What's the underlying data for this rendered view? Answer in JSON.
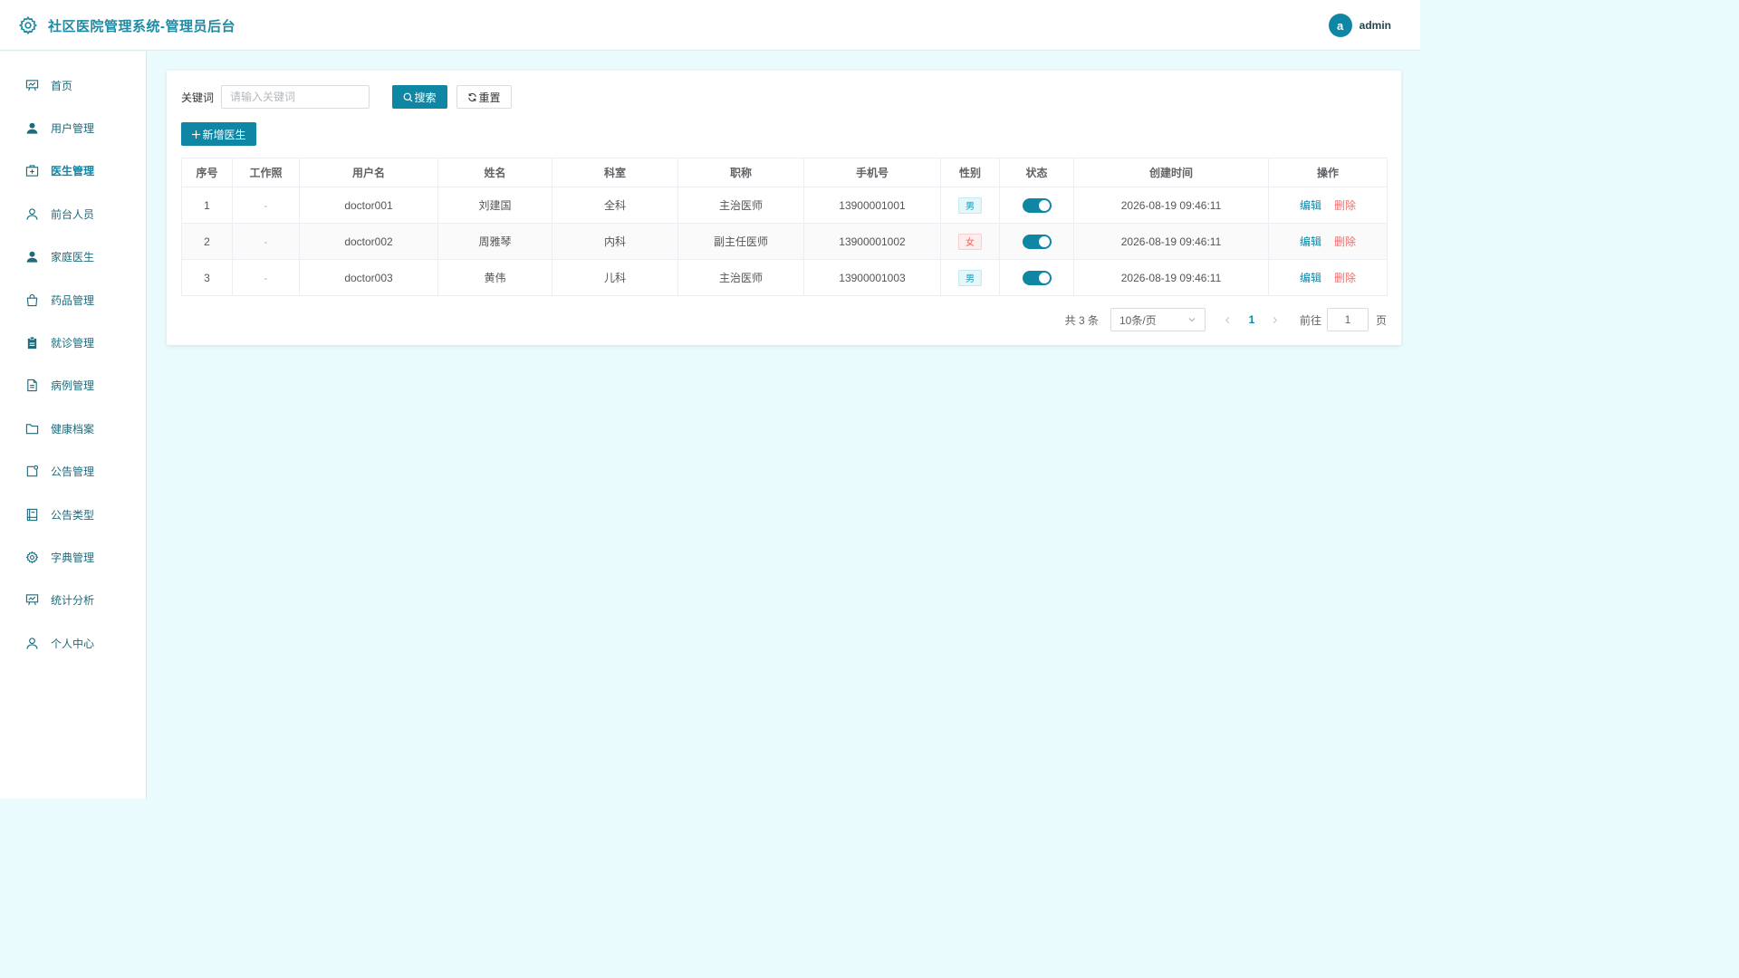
{
  "header": {
    "title": "社区医院管理系统-管理员后台",
    "avatar_letter": "a",
    "username": "admin",
    "logo_icon": "gear-icon"
  },
  "sidebar": {
    "items": [
      {
        "label": "首页",
        "icon": "presentation-icon"
      },
      {
        "label": "用户管理",
        "icon": "user-filled-icon"
      },
      {
        "label": "医生管理",
        "icon": "medical-box-icon"
      },
      {
        "label": "前台人员",
        "icon": "user-icon"
      },
      {
        "label": "家庭医生",
        "icon": "user-filled-icon"
      },
      {
        "label": "药品管理",
        "icon": "shopping-bag-icon"
      },
      {
        "label": "就诊管理",
        "icon": "clipboard-icon"
      },
      {
        "label": "病例管理",
        "icon": "document-icon"
      },
      {
        "label": "健康档案",
        "icon": "folder-icon"
      },
      {
        "label": "公告管理",
        "icon": "notice-icon"
      },
      {
        "label": "公告类型",
        "icon": "notebook-icon"
      },
      {
        "label": "字典管理",
        "icon": "gear-icon"
      },
      {
        "label": "统计分析",
        "icon": "presentation-icon"
      },
      {
        "label": "个人中心",
        "icon": "user-icon"
      }
    ],
    "active_index": 2
  },
  "search": {
    "label": "关键词",
    "placeholder": "请输入关键词",
    "value": "",
    "search_button": "搜索",
    "reset_button": "重置"
  },
  "toolbar": {
    "add_button": "新增医生"
  },
  "table": {
    "columns": [
      "序号",
      "工作照",
      "用户名",
      "姓名",
      "科室",
      "职称",
      "手机号",
      "性别",
      "状态",
      "创建时间",
      "操作"
    ],
    "rows": [
      {
        "index": "1",
        "photo": "-",
        "username": "doctor001",
        "name": "刘建国",
        "dept": "全科",
        "title": "主治医师",
        "phone": "13900001001",
        "gender": "男",
        "status_on": true,
        "created": "2026-08-19 09:46:11",
        "edit": "编辑",
        "delete": "删除"
      },
      {
        "index": "2",
        "photo": "-",
        "username": "doctor002",
        "name": "周雅琴",
        "dept": "内科",
        "title": "副主任医师",
        "phone": "13900001002",
        "gender": "女",
        "status_on": true,
        "created": "2026-08-19 09:46:11",
        "edit": "编辑",
        "delete": "删除"
      },
      {
        "index": "3",
        "photo": "-",
        "username": "doctor003",
        "name": "黄伟",
        "dept": "儿科",
        "title": "主治医师",
        "phone": "13900001003",
        "gender": "男",
        "status_on": true,
        "created": "2026-08-19 09:46:11",
        "edit": "编辑",
        "delete": "删除"
      }
    ]
  },
  "pagination": {
    "total_text": "共 3 条",
    "page_size": "10条/页",
    "current_page": "1",
    "goto_label": "前往",
    "goto_value": "1",
    "goto_unit": "页"
  },
  "colors": {
    "primary": "#0e86a4",
    "danger": "#f56c6c",
    "background": "#e9fbfd"
  }
}
